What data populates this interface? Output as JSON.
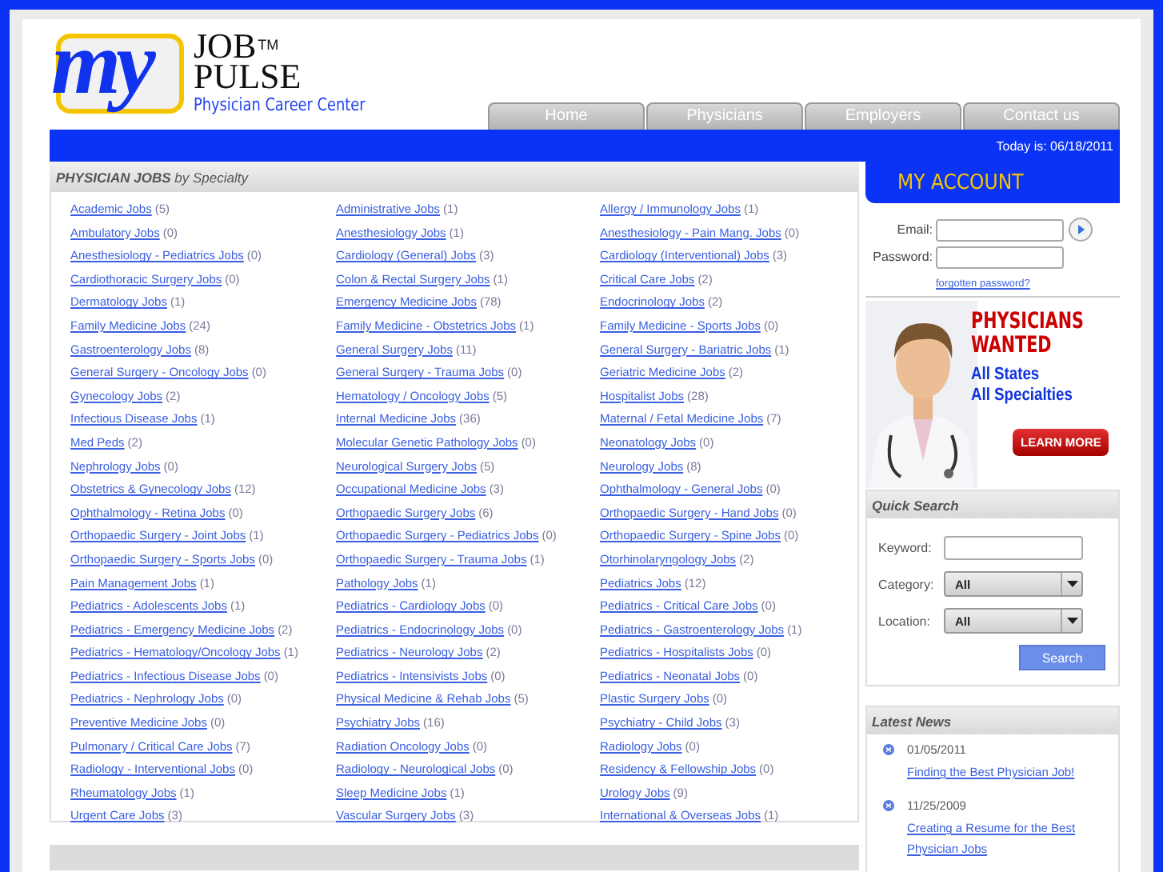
{
  "logo": {
    "mark": "my",
    "word1": "JOB",
    "tm": "TM",
    "word2": "PULSE",
    "tagline": "Physician Career Center"
  },
  "nav": [
    "Home",
    "Physicians",
    "Employers",
    "Contact us"
  ],
  "date_bar": "Today is: 06/18/2011",
  "jobs_panel": {
    "title": "PHYSICIAN JOBS",
    "subtitle": "by Specialty",
    "items": [
      {
        "name": "Academic Jobs",
        "count": "(5)"
      },
      {
        "name": "Administrative Jobs",
        "count": "(1)"
      },
      {
        "name": "Allergy / Immunology Jobs",
        "count": "(1)"
      },
      {
        "name": "Ambulatory Jobs",
        "count": "(0)"
      },
      {
        "name": "Anesthesiology Jobs",
        "count": "(1)"
      },
      {
        "name": "Anesthesiology - Pain Mang. Jobs",
        "count": "(0)"
      },
      {
        "name": "Anesthesiology - Pediatrics Jobs",
        "count": "(0)"
      },
      {
        "name": "Cardiology (General) Jobs",
        "count": "(3)"
      },
      {
        "name": "Cardiology (Interventional) Jobs",
        "count": "(3)"
      },
      {
        "name": "Cardiothoracic Surgery Jobs",
        "count": "(0)"
      },
      {
        "name": "Colon & Rectal Surgery Jobs",
        "count": "(1)"
      },
      {
        "name": "Critical Care Jobs",
        "count": "(2)"
      },
      {
        "name": "Dermatology Jobs",
        "count": "(1)"
      },
      {
        "name": "Emergency Medicine Jobs",
        "count": "(78)"
      },
      {
        "name": "Endocrinology Jobs",
        "count": "(2)"
      },
      {
        "name": "Family Medicine Jobs",
        "count": "(24)"
      },
      {
        "name": "Family Medicine - Obstetrics Jobs",
        "count": "(1)"
      },
      {
        "name": "Family Medicine - Sports Jobs",
        "count": "(0)"
      },
      {
        "name": "Gastroenterology Jobs",
        "count": "(8)"
      },
      {
        "name": "General Surgery Jobs",
        "count": "(11)"
      },
      {
        "name": "General Surgery - Bariatric Jobs",
        "count": "(1)"
      },
      {
        "name": "General Surgery - Oncology Jobs",
        "count": "(0)"
      },
      {
        "name": "General Surgery - Trauma Jobs",
        "count": "(0)"
      },
      {
        "name": "Geriatric Medicine Jobs",
        "count": "(2)"
      },
      {
        "name": "Gynecology Jobs",
        "count": "(2)"
      },
      {
        "name": "Hematology / Oncology Jobs",
        "count": "(5)"
      },
      {
        "name": "Hospitalist Jobs",
        "count": "(28)"
      },
      {
        "name": "Infectious Disease Jobs",
        "count": "(1)"
      },
      {
        "name": "Internal Medicine Jobs",
        "count": "(36)"
      },
      {
        "name": "Maternal / Fetal Medicine Jobs",
        "count": "(7)"
      },
      {
        "name": "Med Peds",
        "count": "(2)"
      },
      {
        "name": "Molecular Genetic Pathology Jobs",
        "count": "(0)"
      },
      {
        "name": "Neonatology Jobs",
        "count": "(0)"
      },
      {
        "name": "Nephrology Jobs",
        "count": "(0)"
      },
      {
        "name": "Neurological Surgery Jobs",
        "count": "(5)"
      },
      {
        "name": "Neurology Jobs",
        "count": "(8)"
      },
      {
        "name": "Obstetrics & Gynecology Jobs",
        "count": "(12)"
      },
      {
        "name": "Occupational Medicine Jobs",
        "count": "(3)"
      },
      {
        "name": "Ophthalmology - General Jobs",
        "count": "(0)"
      },
      {
        "name": "Ophthalmology - Retina Jobs",
        "count": "(0)"
      },
      {
        "name": "Orthopaedic Surgery Jobs",
        "count": "(6)"
      },
      {
        "name": "Orthopaedic Surgery - Hand Jobs",
        "count": "(0)"
      },
      {
        "name": "Orthopaedic Surgery - Joint Jobs",
        "count": "(1)"
      },
      {
        "name": "Orthopaedic Surgery - Pediatrics Jobs",
        "count": "(0)"
      },
      {
        "name": "Orthopaedic Surgery - Spine Jobs",
        "count": "(0)"
      },
      {
        "name": "Orthopaedic Surgery - Sports Jobs",
        "count": "(0)"
      },
      {
        "name": "Orthopaedic Surgery - Trauma Jobs",
        "count": "(1)"
      },
      {
        "name": "Otorhinolaryngology Jobs",
        "count": "(2)"
      },
      {
        "name": "Pain Management Jobs",
        "count": "(1)"
      },
      {
        "name": "Pathology Jobs",
        "count": "(1)"
      },
      {
        "name": "Pediatrics Jobs",
        "count": "(12)"
      },
      {
        "name": "Pediatrics - Adolescents Jobs",
        "count": "(1)"
      },
      {
        "name": "Pediatrics - Cardiology Jobs",
        "count": "(0)"
      },
      {
        "name": "Pediatrics - Critical Care Jobs",
        "count": "(0)"
      },
      {
        "name": "Pediatrics - Emergency Medicine Jobs",
        "count": "(2)"
      },
      {
        "name": "Pediatrics - Endocrinology Jobs",
        "count": "(0)"
      },
      {
        "name": "Pediatrics - Gastroenterology Jobs",
        "count": "(1)"
      },
      {
        "name": "Pediatrics - Hematology/Oncology Jobs",
        "count": "(1)"
      },
      {
        "name": "Pediatrics - Neurology Jobs",
        "count": "(2)"
      },
      {
        "name": "Pediatrics - Hospitalists Jobs",
        "count": "(0)"
      },
      {
        "name": "Pediatrics - Infectious Disease Jobs",
        "count": "(0)"
      },
      {
        "name": "Pediatrics - Intensivists Jobs",
        "count": "(0)"
      },
      {
        "name": "Pediatrics - Neonatal Jobs",
        "count": "(0)"
      },
      {
        "name": "Pediatrics - Nephrology Jobs",
        "count": "(0)"
      },
      {
        "name": "Physical Medicine & Rehab Jobs",
        "count": "(5)"
      },
      {
        "name": "Plastic Surgery Jobs",
        "count": "(0)"
      },
      {
        "name": "Preventive Medicine Jobs",
        "count": "(0)"
      },
      {
        "name": "Psychiatry Jobs",
        "count": "(16)"
      },
      {
        "name": "Psychiatry - Child Jobs",
        "count": "(3)"
      },
      {
        "name": "Pulmonary / Critical Care Jobs",
        "count": "(7)"
      },
      {
        "name": "Radiation Oncology Jobs",
        "count": "(0)"
      },
      {
        "name": "Radiology Jobs",
        "count": "(0)"
      },
      {
        "name": "Radiology - Interventional Jobs",
        "count": "(0)"
      },
      {
        "name": "Radiology - Neurological Jobs",
        "count": "(0)"
      },
      {
        "name": "Residency & Fellowship Jobs",
        "count": "(0)"
      },
      {
        "name": "Rheumatology Jobs",
        "count": "(1)"
      },
      {
        "name": "Sleep Medicine Jobs",
        "count": "(1)"
      },
      {
        "name": "Urology Jobs",
        "count": "(9)"
      },
      {
        "name": "Urgent Care Jobs",
        "count": "(3)"
      },
      {
        "name": "Vascular Surgery Jobs",
        "count": "(3)"
      },
      {
        "name": "International & Overseas Jobs",
        "count": "(1)"
      }
    ]
  },
  "account": {
    "title": "MY ACCOUNT",
    "email_label": "Email:",
    "password_label": "Password:",
    "forgot_link": "forgotten password?"
  },
  "ad": {
    "kind": "picture",
    "headline1": "PHYSICIANS",
    "headline2": "WANTED",
    "line1": "All States",
    "line2": "All Specialties",
    "button": "LEARN MORE"
  },
  "quick_search": {
    "title": "Quick Search",
    "keyword_label": "Keyword:",
    "category_label": "Category:",
    "category_value": "All",
    "location_label": "Location:",
    "location_value": "All",
    "button": "Search"
  },
  "latest_news": {
    "title": "Latest News",
    "items": [
      {
        "date": "01/05/2011",
        "title": "Finding the Best Physician Job!"
      },
      {
        "date": "11/25/2009",
        "title": "Creating a Resume for the Best Physician Jobs"
      }
    ]
  }
}
